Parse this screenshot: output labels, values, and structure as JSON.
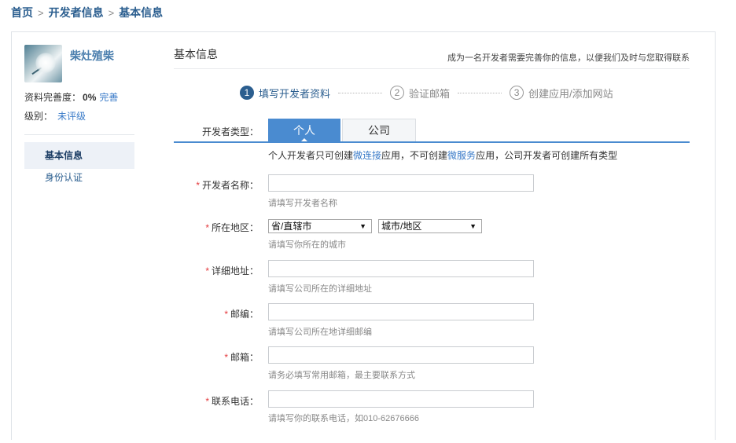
{
  "breadcrumb": {
    "home": "首页",
    "section": "开发者信息",
    "current": "基本信息",
    "separator": ">"
  },
  "sidebar": {
    "user_name": "柴灶殖柴",
    "completion_label": "资料完善度：",
    "completion_value": "0%",
    "completion_link": "完善",
    "level_label": "级别：",
    "level_value": "未评级",
    "nav": [
      {
        "label": "基本信息",
        "active": true
      },
      {
        "label": "身份认证",
        "active": false
      }
    ]
  },
  "main": {
    "title": "基本信息",
    "hint": "成为一名开发者需要完善你的信息，以便我们及时与您取得联系",
    "steps": [
      {
        "num": "1",
        "label": "填写开发者资料",
        "active": true
      },
      {
        "num": "2",
        "label": "验证邮箱",
        "active": false
      },
      {
        "num": "3",
        "label": "创建应用/添加网站",
        "active": false
      }
    ],
    "developer_type": {
      "label": "开发者类型：",
      "tabs": [
        {
          "label": "个人",
          "selected": true
        },
        {
          "label": "公司",
          "selected": false
        }
      ],
      "desc_part1": "个人开发者只可创建",
      "desc_hl1": "微连接",
      "desc_part2": "应用，不可创建",
      "desc_hl2": "微服务",
      "desc_part3": "应用，公司开发者可创建所有类型"
    },
    "fields": {
      "name": {
        "label": "开发者名称：",
        "value": "",
        "help": "请填写开发者名称"
      },
      "region": {
        "label": "所在地区：",
        "province": "省/直辖市",
        "city": "城市/地区",
        "help": "请填写你所在的城市"
      },
      "address": {
        "label": "详细地址：",
        "value": "",
        "help": "请填写公司所在的详细地址"
      },
      "postcode": {
        "label": "邮编：",
        "value": "",
        "help": "请填写公司所在地详细邮编"
      },
      "email": {
        "label": "邮箱：",
        "value": "",
        "help": "请务必填写常用邮箱，最主要联系方式"
      },
      "phone": {
        "label": "联系电话：",
        "value": "",
        "help": "请填写你的联系电话，如010-62676666"
      }
    },
    "required_mark": "*"
  },
  "colors": {
    "accent": "#4a8bd0",
    "link": "#3a7bc8",
    "heading": "#2b5e8f",
    "required": "#e4393c"
  }
}
